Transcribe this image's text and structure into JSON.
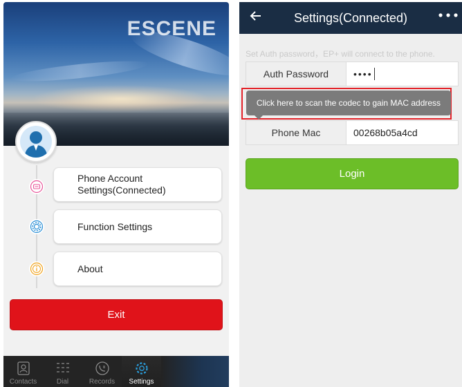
{
  "left": {
    "brand": "ESCENE",
    "menu": [
      {
        "label": "Phone Account Settings(Connected)",
        "icon": "phone-icon",
        "color": "#e8559a"
      },
      {
        "label": "Function Settings",
        "icon": "gear-icon",
        "color": "#2a8fd6"
      },
      {
        "label": "About",
        "icon": "info-icon",
        "color": "#f0a21a"
      }
    ],
    "exit_label": "Exit",
    "exit_color": "#e0131a",
    "tabs": [
      {
        "label": "Contacts",
        "icon": "contacts-icon"
      },
      {
        "label": "Dial",
        "icon": "dialpad-icon"
      },
      {
        "label": "Records",
        "icon": "call-records-icon"
      },
      {
        "label": "Settings",
        "icon": "settings-icon",
        "active": true
      }
    ]
  },
  "right": {
    "title": "Settings(Connected)",
    "hint": "Set Auth password，EP+ will connect to the phone.",
    "auth_label": "Auth Password",
    "auth_value": "••••",
    "tooltip": "Click here to scan the codec to gain MAC address",
    "mac_label": "Phone Mac",
    "mac_value": "00268b05a4cd",
    "login_label": "Login",
    "login_color": "#6cbe28",
    "header_color": "#1a2d44"
  }
}
